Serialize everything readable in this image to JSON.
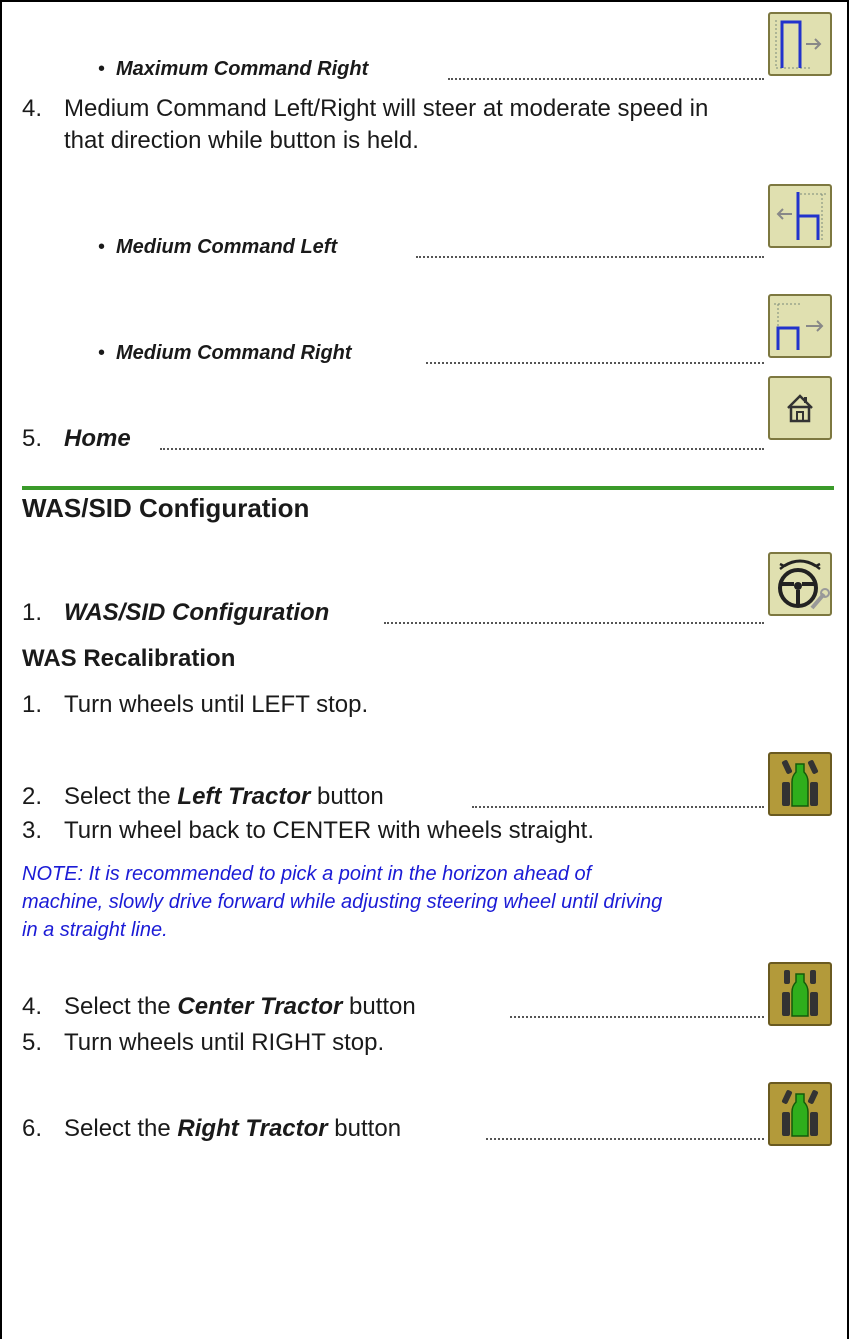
{
  "items": {
    "max_right": "Maximum Command Right",
    "medium_desc_line1": "Medium Command Left/Right will steer at moderate speed in",
    "medium_desc_line2": "that direction while button is held.",
    "medium_left": "Medium Command Left",
    "medium_right": "Medium Command Right",
    "home": "Home",
    "bullet": "•"
  },
  "numbers": {
    "n4": "4.",
    "n5": "5.",
    "n1": "1."
  },
  "was_sid": {
    "heading": "WAS/SID Configuration",
    "step1": "WAS/SID Configuration"
  },
  "recal": {
    "heading": "WAS Recalibration",
    "steps": [
      {
        "num": "1.",
        "text": "Turn wheels until LEFT stop."
      },
      {
        "num": "2.",
        "pre": "Select the ",
        "bold": "Left Tractor",
        "post": " button"
      },
      {
        "num": "3.",
        "text": "Turn wheel back to CENTER with wheels straight."
      },
      {
        "num": "4.",
        "pre": "Select the ",
        "bold": "Center Tractor",
        "post": " button"
      },
      {
        "num": "5.",
        "text": "Turn wheels until RIGHT stop."
      },
      {
        "num": "6.",
        "pre": "Select the ",
        "bold": "Right Tractor",
        "post": " button"
      }
    ],
    "note_line1": "NOTE: It is recommended to pick a point in the horizon ahead of",
    "note_line2": "machine, slowly drive forward while adjusting steering wheel until driving",
    "note_line3": "in a straight line."
  },
  "icons": {
    "max_right": "maximum-command-right-icon",
    "medium_left": "medium-command-left-icon",
    "medium_right": "medium-command-right-icon",
    "home": "home-icon",
    "was_sid": "steering-wheel-wrench-icon",
    "left_tractor": "left-tractor-icon",
    "center_tractor": "center-tractor-icon",
    "right_tractor": "right-tractor-icon"
  },
  "colors": {
    "note": "#1b1bd6",
    "rule": "#3a9a2a",
    "tractor_green": "#2fae1c"
  }
}
